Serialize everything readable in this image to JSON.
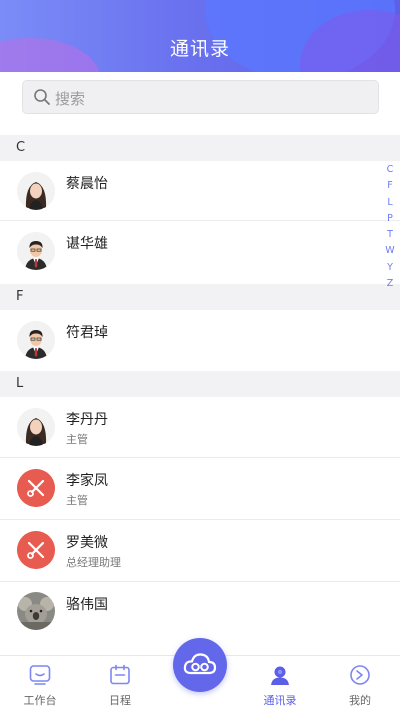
{
  "header": {
    "title": "通讯录"
  },
  "search": {
    "placeholder": "搜索"
  },
  "sections": [
    {
      "letter": "C",
      "contacts": [
        {
          "name": "蔡晨怡",
          "role": ""
        },
        {
          "name": "谌华雄",
          "role": ""
        }
      ]
    },
    {
      "letter": "F",
      "contacts": [
        {
          "name": "符君琸",
          "role": ""
        }
      ]
    },
    {
      "letter": "L",
      "contacts": [
        {
          "name": "李丹丹",
          "role": "主管"
        },
        {
          "name": "李家凤",
          "role": "主管"
        },
        {
          "name": "罗美微",
          "role": "总经理助理"
        },
        {
          "name": "骆伟国",
          "role": ""
        }
      ]
    }
  ],
  "index_letters": [
    "C",
    "F",
    "L",
    "P",
    "T",
    "W",
    "Y",
    "Z"
  ],
  "tabbar": {
    "tabs": [
      {
        "label": "工作台",
        "icon": "workbench-icon"
      },
      {
        "label": "日程",
        "icon": "calendar-icon"
      },
      {
        "label": "通讯录",
        "icon": "contacts-icon",
        "active": true
      },
      {
        "label": "我的",
        "icon": "profile-icon"
      }
    ],
    "center_icon": "cloud-icon"
  },
  "colors": {
    "accent": "#5b5fe6",
    "header_gradient_start": "#7b8cf7",
    "header_gradient_end": "#5d5fe8",
    "avatar_red": "#e85b50"
  }
}
